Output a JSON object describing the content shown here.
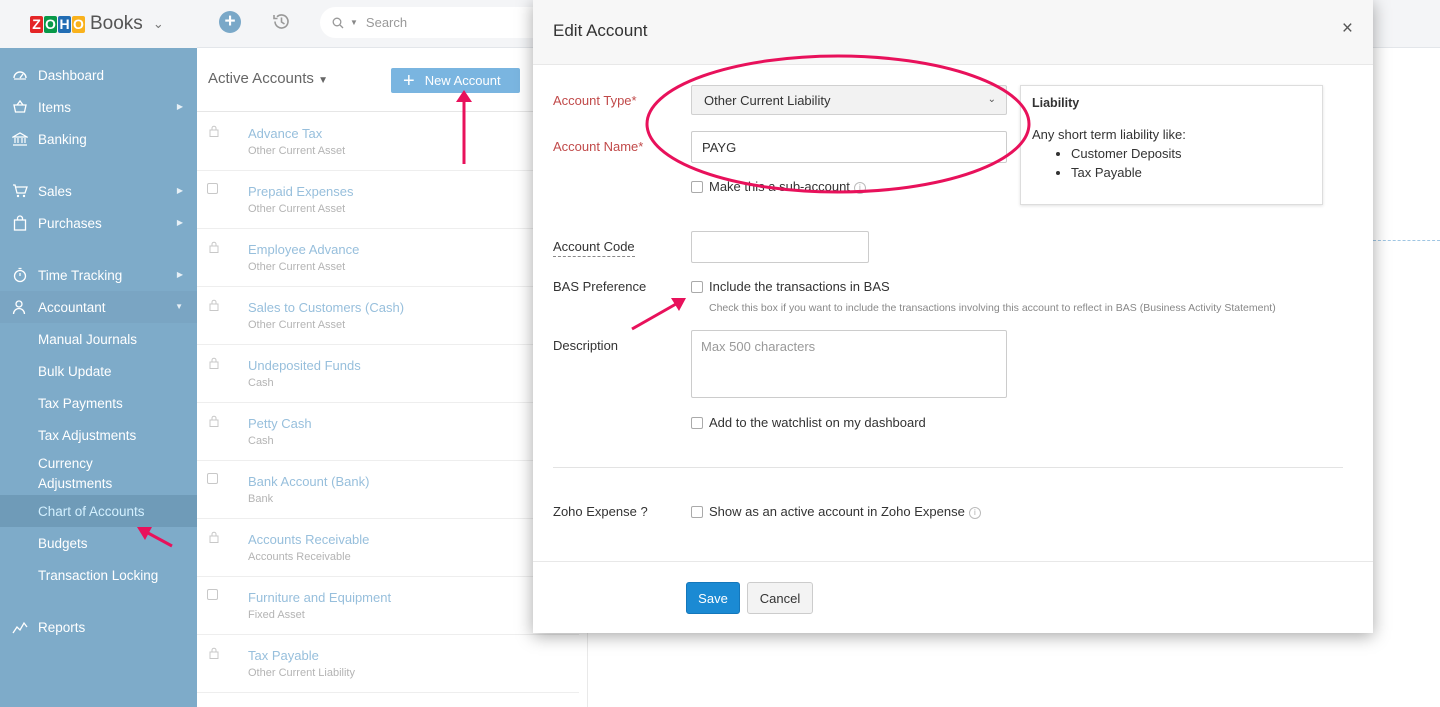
{
  "brand": {
    "logo_letters": [
      "Z",
      "O",
      "H",
      "O"
    ],
    "logo_colors": [
      "#e42527",
      "#089949",
      "#226db4",
      "#f9b21d"
    ],
    "product": "Books"
  },
  "sidebar": {
    "items": [
      {
        "label": "Dashboard",
        "icon": "dashboard-icon"
      },
      {
        "label": "Items",
        "icon": "basket-icon"
      },
      {
        "label": "Banking",
        "icon": "bank-icon"
      },
      {
        "label": "Sales",
        "icon": "cart-icon"
      },
      {
        "label": "Purchases",
        "icon": "bag-icon"
      },
      {
        "label": "Time Tracking",
        "icon": "stopwatch-icon"
      },
      {
        "label": "Accountant",
        "icon": "person-icon"
      },
      {
        "label": "Manual Journals"
      },
      {
        "label": "Bulk Update"
      },
      {
        "label": "Tax Payments"
      },
      {
        "label": "Tax Adjustments"
      },
      {
        "label": "Currency Adjustments",
        "line1": "Currency",
        "line2": "Adjustments"
      },
      {
        "label": "Chart of Accounts"
      },
      {
        "label": "Budgets"
      },
      {
        "label": "Transaction Locking"
      },
      {
        "label": "Reports",
        "icon": "reports-icon"
      }
    ]
  },
  "topbar": {
    "search_placeholder": "Search"
  },
  "list": {
    "title": "Active Accounts",
    "new_button": "New Account",
    "rows": [
      {
        "name": "Advance Tax",
        "type": "Other Current Asset",
        "locked": true
      },
      {
        "name": "Prepaid Expenses",
        "type": "Other Current Asset",
        "locked": false
      },
      {
        "name": "Employee Advance",
        "type": "Other Current Asset",
        "locked": true
      },
      {
        "name": "Sales to Customers (Cash)",
        "type": "Other Current Asset",
        "locked": true
      },
      {
        "name": "Undeposited Funds",
        "type": "Cash",
        "locked": true
      },
      {
        "name": "Petty Cash",
        "type": "Cash",
        "locked": true
      },
      {
        "name": "Bank Account (Bank)",
        "type": "Bank",
        "locked": false
      },
      {
        "name": "Accounts Receivable",
        "type": "Accounts Receivable",
        "locked": true
      },
      {
        "name": "Furniture and Equipment",
        "type": "Fixed Asset",
        "locked": false
      },
      {
        "name": "Tax Payable",
        "type": "Other Current Liability",
        "locked": true
      }
    ]
  },
  "modal": {
    "title": "Edit Account",
    "close": "×",
    "account_type_label": "Account Type*",
    "account_type_value": "Other Current Liability",
    "account_name_label": "Account Name*",
    "account_name_value": "PAYG",
    "sub_account_label": "Make this a sub-account",
    "account_code_label": "Account Code",
    "account_code_value": "",
    "bas_label": "BAS Preference",
    "bas_checkbox_label": "Include the transactions in BAS",
    "bas_hint": "Check this box if you want to include the transactions involving this account to reflect in BAS (Business Activity Statement)",
    "description_label": "Description",
    "description_placeholder": "Max 500 characters",
    "watchlist_label": "Add to the watchlist on my dashboard",
    "zoho_expense_label": "Zoho Expense ?",
    "zoho_expense_checkbox_label": "Show as an active account in Zoho Expense",
    "save": "Save",
    "cancel": "Cancel",
    "info": {
      "title": "Liability",
      "text": "Any short term liability like:",
      "bullets": [
        "Customer Deposits",
        "Tax Payable"
      ]
    }
  },
  "colors": {
    "annotation": "#e8115b",
    "sidebar_bg": "#7eabc9",
    "primary": "#1b8ad3"
  }
}
